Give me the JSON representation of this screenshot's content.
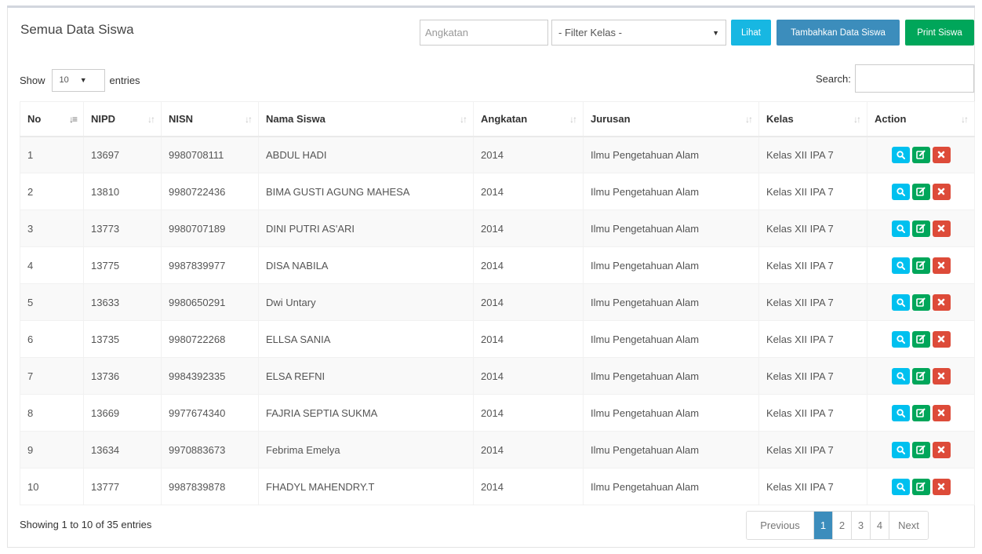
{
  "header": {
    "title": "Semua Data Siswa",
    "angkatan_placeholder": "Angkatan",
    "kelas_filter_selected": "- Filter Kelas -",
    "lihat_label": "Lihat",
    "tambah_label": "Tambahkan Data Siswa",
    "print_label": "Print Siswa"
  },
  "controls": {
    "show_label": "Show",
    "entries_value": "10",
    "entries_label": "entries",
    "search_label": "Search:"
  },
  "table": {
    "columns": [
      "No",
      "NIPD",
      "NISN",
      "Nama Siswa",
      "Angkatan",
      "Jurusan",
      "Kelas",
      "Action"
    ],
    "rows": [
      [
        "1",
        "13697",
        "9980708111",
        "ABDUL HADI",
        "2014",
        "Ilmu Pengetahuan Alam",
        "Kelas XII IPA 7"
      ],
      [
        "2",
        "13810",
        "9980722436",
        "BIMA GUSTI AGUNG MAHESA",
        "2014",
        "Ilmu Pengetahuan Alam",
        "Kelas XII IPA 7"
      ],
      [
        "3",
        "13773",
        "9980707189",
        "DINI PUTRI AS'ARI",
        "2014",
        "Ilmu Pengetahuan Alam",
        "Kelas XII IPA 7"
      ],
      [
        "4",
        "13775",
        "9987839977",
        "DISA NABILA",
        "2014",
        "Ilmu Pengetahuan Alam",
        "Kelas XII IPA 7"
      ],
      [
        "5",
        "13633",
        "9980650291",
        "Dwi Untary",
        "2014",
        "Ilmu Pengetahuan Alam",
        "Kelas XII IPA 7"
      ],
      [
        "6",
        "13735",
        "9980722268",
        "ELLSA SANIA",
        "2014",
        "Ilmu Pengetahuan Alam",
        "Kelas XII IPA 7"
      ],
      [
        "7",
        "13736",
        "9984392335",
        "ELSA REFNI",
        "2014",
        "Ilmu Pengetahuan Alam",
        "Kelas XII IPA 7"
      ],
      [
        "8",
        "13669",
        "9977674340",
        "FAJRIA SEPTIA SUKMA",
        "2014",
        "Ilmu Pengetahuan Alam",
        "Kelas XII IPA 7"
      ],
      [
        "9",
        "13634",
        "9970883673",
        "Febrima Emelya",
        "2014",
        "Ilmu Pengetahuan Alam",
        "Kelas XII IPA 7"
      ],
      [
        "10",
        "13777",
        "9987839878",
        "FHADYL MAHENDRY.T",
        "2014",
        "Ilmu Pengetahuan Alam",
        "Kelas XII IPA 7"
      ]
    ],
    "action_icons": [
      "search-icon",
      "edit-icon",
      "delete-icon"
    ]
  },
  "footer": {
    "info": "Showing 1 to 10 of 35 entries",
    "prev_label": "Previous",
    "next_label": "Next",
    "pages": [
      "1",
      "2",
      "3",
      "4"
    ],
    "active_page": "1"
  },
  "colors": {
    "info": "#00c0ef",
    "primary": "#3c8dbc",
    "success": "#00a65a",
    "danger": "#dd4b39"
  }
}
